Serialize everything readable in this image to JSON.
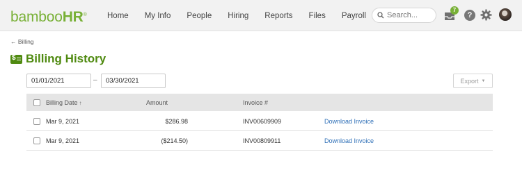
{
  "header": {
    "logo": {
      "text_main": "bamboo",
      "text_hr": "HR",
      "reg": "®"
    },
    "nav": [
      "Home",
      "My Info",
      "People",
      "Hiring",
      "Reports",
      "Files",
      "Payroll"
    ],
    "search": {
      "placeholder": "Search..."
    },
    "inbox_count": "7",
    "help_label": "?"
  },
  "breadcrumb": "← Billing",
  "page": {
    "title": "Billing History"
  },
  "filters": {
    "start_date": "01/01/2021",
    "end_date": "03/30/2021",
    "separator": "–",
    "export_label": "Export"
  },
  "table": {
    "columns": {
      "date": "Billing Date",
      "sort_indicator": "↑",
      "amount": "Amount",
      "invoice": "Invoice #"
    },
    "rows": [
      {
        "date": "Mar 9, 2021",
        "amount": "$286.98",
        "invoice": "INV00609909",
        "action": "Download Invoice"
      },
      {
        "date": "Mar 9, 2021",
        "amount": "($214.50)",
        "invoice": "INV00809911",
        "action": "Download Invoice"
      }
    ]
  },
  "colors": {
    "brand_green": "#78b036",
    "title_green": "#4f8a10",
    "link_blue": "#2e6fb7",
    "header_bg": "#f2f2f2",
    "table_head_bg": "#e5e5e5"
  },
  "icons": [
    "search-icon",
    "inbox-icon",
    "help-icon",
    "gear-icon",
    "avatar",
    "billing-icon",
    "sort-arrow-icon",
    "chevron-down-icon",
    "back-arrow-icon"
  ]
}
